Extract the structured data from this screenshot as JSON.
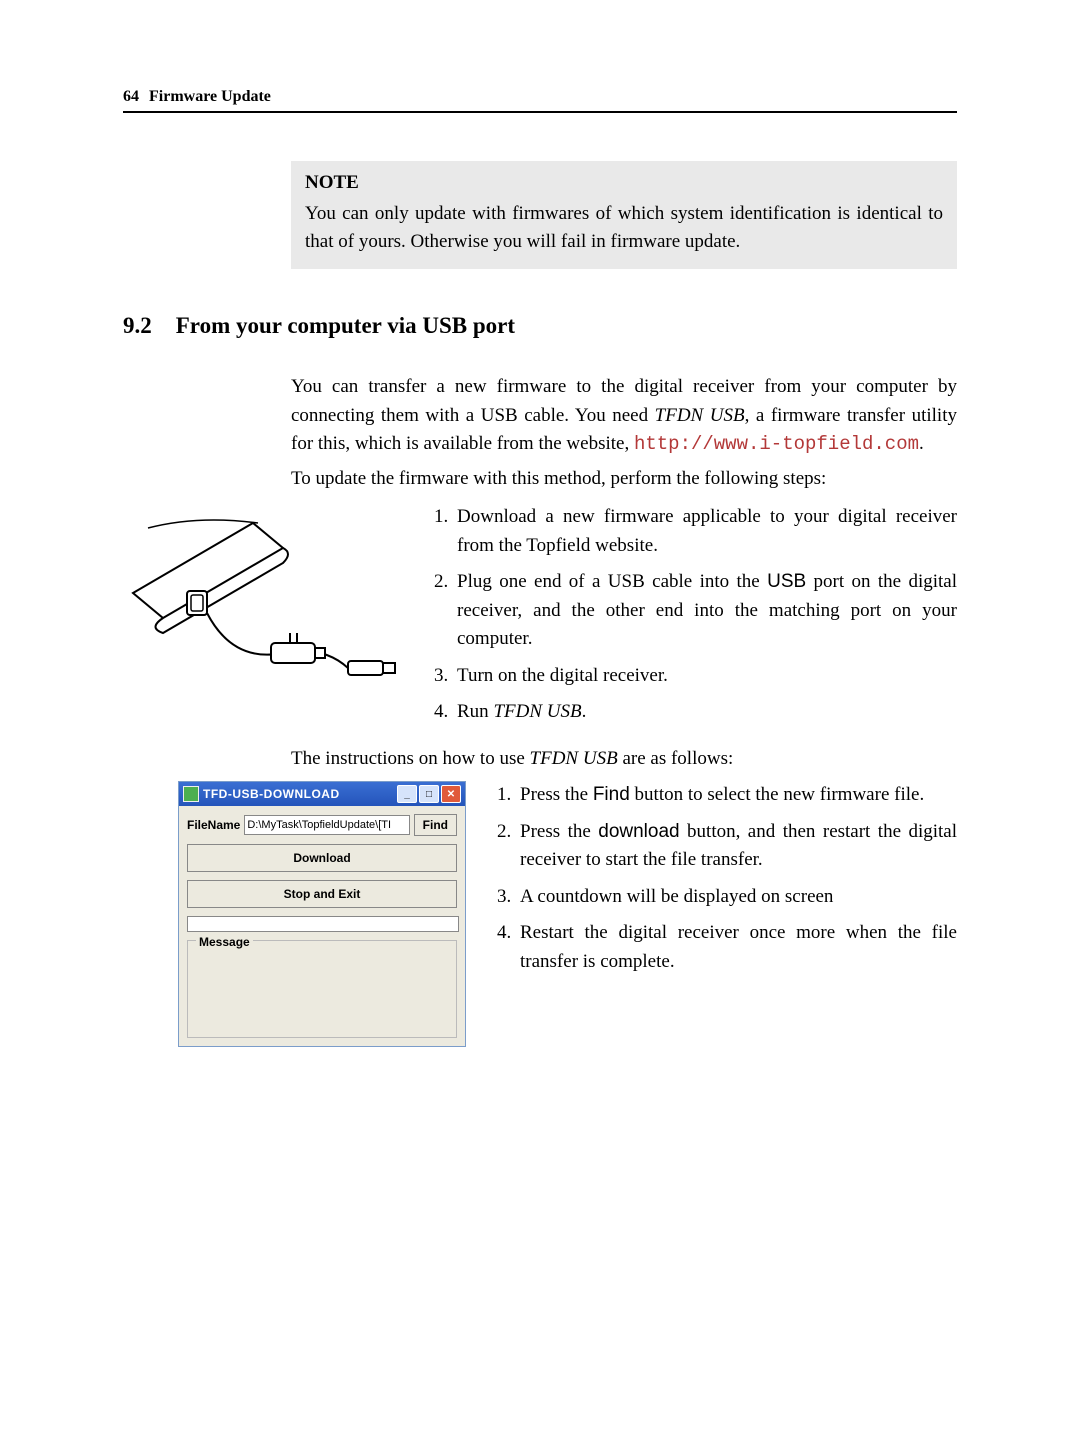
{
  "header": {
    "page_num": "64",
    "chapter": "Firmware Update"
  },
  "note": {
    "title": "NOTE",
    "body": "You can only update with firmwares of which system identification is identical to that of yours. Otherwise you will fail in firmware update."
  },
  "section": {
    "num": "9.2",
    "title": "From your computer via USB port"
  },
  "body": {
    "p1_a": "You can transfer a new firmware to the digital receiver from your computer by connecting them with a USB cable. You need ",
    "p1_util": "TFDN USB",
    "p1_b": ", a firmware transfer utility for this, which is available from the website, ",
    "p1_url": "http://www.i-topfield.com",
    "p1_c": ".",
    "p2": "To update the firmware with this method, perform the following steps:",
    "steps_a": {
      "s1": "Download a new firmware applicable to your digital receiver from the Topfield website.",
      "s2_a": "Plug one end of a USB cable into the ",
      "s2_b": "USB",
      "s2_c": " port on the digital receiver, and the other end into the matching port on your computer.",
      "s3": "Turn on the digital receiver.",
      "s4_a": "Run ",
      "s4_b": "TFDN USB",
      "s4_c": "."
    },
    "p3_a": "The instructions on how to use ",
    "p3_b": "TFDN USB",
    "p3_c": " are as follows:",
    "steps_b": {
      "s1_a": "Press the ",
      "s1_btn": "Find",
      "s1_b": " button to select the new firmware file.",
      "s2_a": "Press the ",
      "s2_btn": "download",
      "s2_b": " button, and then restart the digital receiver to start the file transfer.",
      "s3": "A countdown will be displayed on screen",
      "s4": "Restart the digital receiver once more when the file transfer is complete."
    }
  },
  "app_window": {
    "title": "TFD-USB-DOWNLOAD",
    "filename_label": "FileName",
    "filename_value": "D:\\MyTask\\TopfieldUpdate\\[TI",
    "find": "Find",
    "download": "Download",
    "stop_exit": "Stop and Exit",
    "message": "Message"
  },
  "icons": {
    "minimize": "_",
    "maximize": "□",
    "close": "✕"
  }
}
